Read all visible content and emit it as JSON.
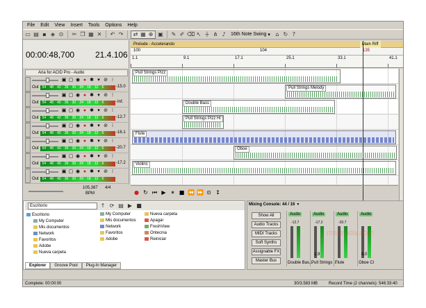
{
  "window": {
    "menu": [
      "File",
      "Edit",
      "View",
      "Insert",
      "Tools",
      "Options",
      "Help"
    ]
  },
  "toolbar": {
    "swing_label": "16th Note Swing"
  },
  "time": {
    "position": "00:00:48,700",
    "measure": "21.4.106"
  },
  "markers": {
    "regions": [
      "Prelude - Accelerando",
      "Main Riff"
    ],
    "tempo_marks": [
      "100",
      "104",
      "135"
    ]
  },
  "ruler": {
    "labels": [
      "1.1",
      "9.1",
      "17.1",
      "25.1",
      "33.1",
      "41.1"
    ]
  },
  "tracks": {
    "header_name": "Aria for ACID Pro - Audio",
    "out_label": "Out",
    "meter_scale": [
      "54",
      "48",
      "42",
      "36",
      "30",
      "24",
      "18",
      "12",
      "6"
    ],
    "items": [
      {
        "value": "-15.0"
      },
      {
        "value": "-Inf."
      },
      {
        "value": "-12.7"
      },
      {
        "value": "-16.1"
      },
      {
        "value": "-20.7"
      },
      {
        "value": "-17.2"
      },
      {
        "value": ""
      }
    ]
  },
  "events": [
    {
      "name": "Pull Strings Pizz"
    },
    {
      "name": "Pull Strings Melody"
    },
    {
      "name": "Double Bass"
    },
    {
      "name": "Pull Strings Pizz Hi"
    },
    {
      "name": "Flute"
    },
    {
      "name": "Oboe"
    },
    {
      "name": "Violins"
    }
  ],
  "tempo": {
    "bpm_value": "105,387",
    "bpm_label": "BPM",
    "sig_top": "4",
    "sig_bottom": "4"
  },
  "explorer": {
    "location": "Escritorio",
    "tree": [
      "Escritorio",
      "My Computer",
      "Mis documentos",
      "Network",
      "Favoritos",
      "Adobe",
      "Nueva carpeta"
    ],
    "files": [
      "My Computer",
      "Nueva carpeta",
      "Mis documentos",
      "Apagar",
      "Network",
      "FreshView",
      "Favoritos",
      "Ontecnia",
      "Adobe",
      "Reiniciar"
    ],
    "tabs": [
      "Explorer",
      "Groove Pool",
      "Plug-In Manager"
    ]
  },
  "mixer": {
    "title": "Mixing Console: 44 / 16",
    "buttons": [
      "Show All",
      "Audio Tracks",
      "MIDI Tracks",
      "Soft Synths",
      "Assignable FX",
      "Master Bus"
    ],
    "strips": [
      {
        "label": "Audio",
        "db": "-12.7",
        "name": "Double Bas..."
      },
      {
        "label": "Audio",
        "db": "-17.2",
        "name": "Pull Strings ..."
      },
      {
        "label": "Audio",
        "db": "-20.7",
        "name": "Flute"
      },
      {
        "label": "Audio",
        "db": "",
        "name": "Oboe Cl"
      }
    ],
    "level_a": "1.9",
    "level_b": "6.0"
  },
  "status": {
    "left": "Complete: 00:00:00",
    "mid": "30/3.583 MB",
    "right": "Record Time (2 channels): 546:33:40"
  },
  "watermark": "malavida.com"
}
